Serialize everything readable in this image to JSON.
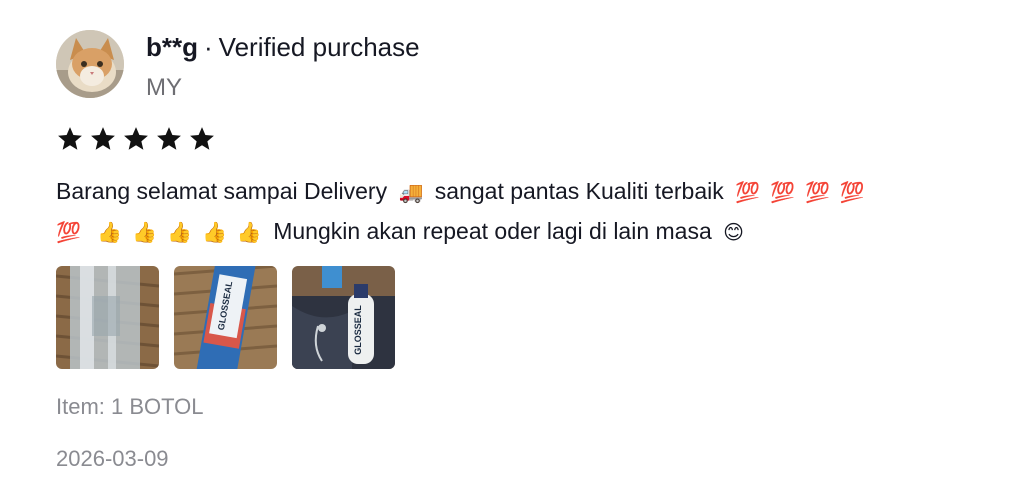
{
  "reviewer": {
    "name": "b**g",
    "separator": "·",
    "badge": "Verified purchase",
    "region": "MY",
    "avatar_icon": "cat-avatar"
  },
  "rating": {
    "stars": 5,
    "max": 5,
    "icon": "star-icon"
  },
  "review": {
    "part1": "Barang selamat sampai Delivery",
    "emoji_delivery": "🚚",
    "part2": "sangat pantas Kualiti terbaik",
    "emoji_hundred": [
      "💯",
      "💯",
      "💯",
      "💯",
      "💯"
    ],
    "emoji_thumbs": [
      "👍",
      "👍",
      "👍",
      "👍",
      "👍"
    ],
    "part3": "Mungkin akan repeat oder lagi di lain masa",
    "emoji_smile": "😊"
  },
  "photos": [
    {
      "name": "review-photo-1",
      "subject": "bottle in plastic bag"
    },
    {
      "name": "review-photo-2",
      "subject": "glosseal box"
    },
    {
      "name": "review-photo-3",
      "subject": "glosseal bottle"
    }
  ],
  "photo_text": "GLOSSEAL",
  "item": "Item: 1 BOTOL",
  "date": "2026-03-09"
}
